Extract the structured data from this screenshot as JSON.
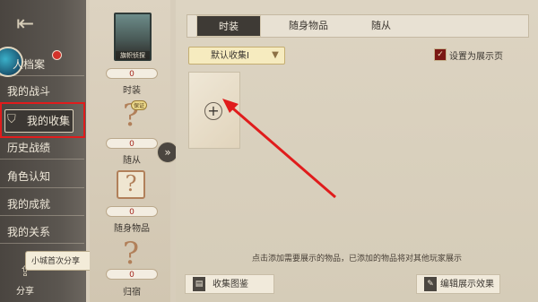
{
  "sidebar": {
    "back_icon": "back-exit-icon",
    "items": [
      {
        "label": "人档案"
      },
      {
        "label": "我的战斗"
      },
      {
        "label": "我的收集"
      },
      {
        "label": "历史战绩"
      },
      {
        "label": "角色认知"
      },
      {
        "label": "我的成就"
      },
      {
        "label": "我的关系"
      }
    ],
    "toast": "小城首次分享",
    "share_label": "分享"
  },
  "collection_column": {
    "portrait_caption": "旗帜侦探",
    "items": [
      {
        "label": "时装",
        "count": "0"
      },
      {
        "label": "随从",
        "count": "0"
      },
      {
        "label": "随身物品",
        "count": "0"
      },
      {
        "label": "归宿",
        "count": "0"
      }
    ],
    "badge": "保证"
  },
  "main": {
    "tabs": [
      {
        "label": "时装",
        "active": true
      },
      {
        "label": "随身物品",
        "active": false
      },
      {
        "label": "随从",
        "active": false
      }
    ],
    "dropdown": {
      "value": "默认收集I"
    },
    "checkbox": {
      "label": "设置为展示页",
      "checked": true
    },
    "hint": "点击添加需要展示的物品，已添加的物品将对其他玩家展示",
    "buttons": {
      "gallery": "收集图鉴",
      "edit_display": "编辑展示效果"
    }
  },
  "colors": {
    "accent_red": "#e01c1c",
    "dark_panel": "#3e3a35"
  }
}
